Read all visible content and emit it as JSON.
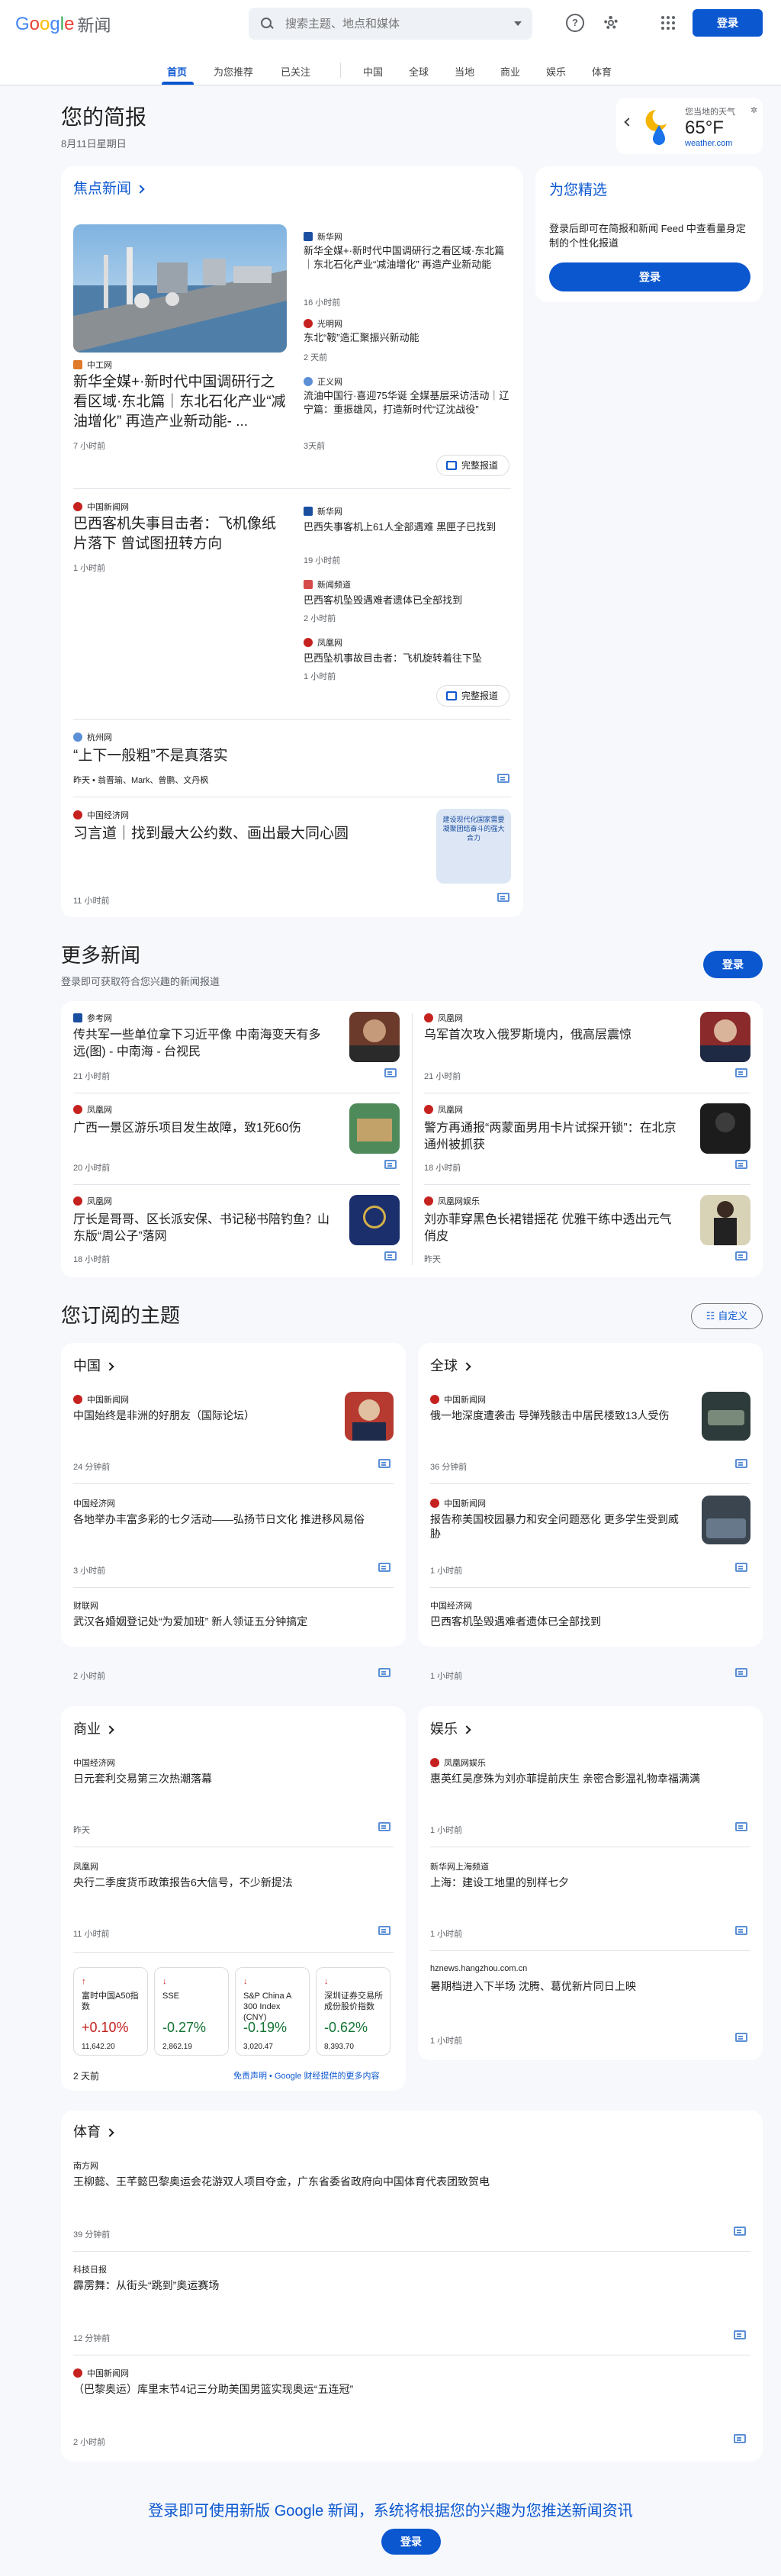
{
  "header": {
    "logo_g": [
      "G",
      "o",
      "o",
      "g",
      "l",
      "e"
    ],
    "logo_news": "新闻",
    "search_placeholder": "搜索主题、地点和媒体",
    "login": "登录",
    "help": "?"
  },
  "nav": {
    "items": [
      "首页",
      "为您推荐",
      "已关注",
      "中国",
      "全球",
      "当地",
      "商业",
      "娱乐",
      "体育"
    ]
  },
  "briefing": {
    "title": "您的简报",
    "date": "8月11日星期日"
  },
  "weather": {
    "location": "您当地的天气",
    "temp": "65°F",
    "source": "weather.com"
  },
  "headlines": {
    "title": "焦点新闻",
    "full_coverage": "完整报道",
    "s1": {
      "main_source": "中工网",
      "main_title": "新华全媒+·新时代中国调研行之看区域·东北篇｜东北石化产业“减油增化” 再造产业新动能- ...",
      "main_time": "7 小时前",
      "side": [
        {
          "source": "新华网",
          "title": "新华全媒+·新时代中国调研行之看区域·东北篇｜东北石化产业“减油增化” 再造产业新动能",
          "time": "16 小时前"
        },
        {
          "source": "光明网",
          "title": "东北“鞍”造汇聚振兴新动能",
          "time": "2 天前"
        },
        {
          "source": "正义网",
          "title": "流油中国行·喜迎75华诞 全媒基层采访活动｜辽宁篇：重振雄风，打造新时代“辽沈战役”",
          "time": "3天前"
        }
      ]
    },
    "s2": {
      "main_source": "中国新闻网",
      "main_title": "巴西客机失事目击者：飞机像纸片落下 曾试图扭转方向",
      "main_time": "1 小时前",
      "side": [
        {
          "source": "新华网",
          "title": "巴西失事客机上61人全部遇难 黑匣子已找到",
          "time": "19 小时前"
        },
        {
          "source": "新闻频道",
          "title": "巴西客机坠毁遇难者遗体已全部找到",
          "time": "2 小时前"
        },
        {
          "source": "凤凰网",
          "title": "巴西坠机事故目击者：飞机旋转着往下坠",
          "time": "1 小时前"
        }
      ]
    },
    "s3": {
      "source": "杭州网",
      "title": "“上下一般粗”不是真落实",
      "meta": "昨天 • 翁晋瑜、Mark、曾鹏、文丹枫"
    },
    "s4": {
      "source": "中国经济网",
      "title": "习言道｜找到最大公约数、画出最大同心圆",
      "time": "11 小时前",
      "img_text": "建设现代化国家需要凝聚团结奋斗的强大合力"
    }
  },
  "picks": {
    "title": "为您精选",
    "desc": "登录后即可在简报和新闻 Feed 中查看量身定制的个性化报道",
    "login": "登录"
  },
  "more": {
    "title": "更多新闻",
    "subtitle": "登录即可获取符合您兴趣的新闻报道",
    "login": "登录",
    "items": [
      {
        "source": "参考网",
        "title": "传共军一些单位拿下习近平像 中南海变天有多远(图) - 中南海 - 台视民",
        "time": "21 小时前"
      },
      {
        "source": "凤凰网",
        "title": "乌军首次攻入俄罗斯境内，俄高层震惊",
        "time": "21 小时前"
      },
      {
        "source": "凤凰网",
        "title": "广西一景区游乐项目发生故障，致1死60伤",
        "time": "20 小时前"
      },
      {
        "source": "凤凰网",
        "title": "警方再通报“两蒙面男用卡片试探开锁”：在北京通州被抓获",
        "time": "18 小时前"
      },
      {
        "source": "凤凰网",
        "title": "厅长是哥哥、区长派安保、书记秘书陪钓鱼？山东版“周公子”落网",
        "time": "18 小时前"
      },
      {
        "source": "凤凰网娱乐",
        "title": "刘亦菲穿黑色长裙错摇花 优雅干练中透出元气俏皮",
        "time": "昨天"
      }
    ]
  },
  "topics": {
    "title": "您订阅的主题",
    "customize": "自定义",
    "china": {
      "title": "中国",
      "items": [
        {
          "source": "中国新闻网",
          "title": "中国始终是非洲的好朋友（国际论坛）",
          "time": "24 分钟前"
        },
        {
          "source": "中国经济网",
          "title": "各地举办丰富多彩的七夕活动——弘扬节日文化 推进移风易俗",
          "time": "3 小时前"
        },
        {
          "source": "财联网",
          "title": "武汉各婚姻登记处“为爱加班” 新人领证五分钟搞定",
          "time": "2 小时前"
        }
      ]
    },
    "world": {
      "title": "全球",
      "items": [
        {
          "source": "中国新闻网",
          "title": "俄一地深度遭袭击 导弹残骸击中居民楼致13人受伤",
          "time": "36 分钟前"
        },
        {
          "source": "中国新闻网",
          "title": "报告称美国校园暴力和安全问题恶化 更多学生受到威胁",
          "time": "1 小时前"
        },
        {
          "source": "中国经济网",
          "title": "巴西客机坠毁遇难者遗体已全部找到",
          "time": "1 小时前"
        }
      ]
    },
    "business": {
      "title": "商业",
      "items": [
        {
          "source": "中国经济网",
          "title": "日元套利交易第三次热潮落幕",
          "time": "昨天"
        },
        {
          "source": "凤凰网",
          "title": "央行二季度货币政策报告6大信号，不少新提法",
          "time": "11 小时前"
        }
      ],
      "stocks": [
        {
          "arrow": "↑",
          "name": "富时中国A50指数",
          "pct": "+0.10%",
          "price": "11,642.20",
          "dir": "up"
        },
        {
          "arrow": "↓",
          "name": "SSE",
          "pct": "-0.27%",
          "price": "2,862.19",
          "dir": "dn"
        },
        {
          "arrow": "↓",
          "name": "S&P China A 300 Index (CNY)",
          "pct": "-0.19%",
          "price": "3,020.47",
          "dir": "dn"
        },
        {
          "arrow": "↓",
          "name": "深圳证券交易所成份股价指数",
          "pct": "-0.62%",
          "price": "8,393.70",
          "dir": "dn"
        }
      ],
      "stock_time": "2 天前",
      "disclaimer": "免责声明 • Google 财经提供的更多内容"
    },
    "ent": {
      "title": "娱乐",
      "items": [
        {
          "source": "凤凰网娱乐",
          "title": "惠英红吴彦殊为刘亦菲提前庆生 亲密合影温礼物幸福满满",
          "time": "1 小时前"
        },
        {
          "source": "新华网上海频道",
          "title": "上海：建设工地里的别样七夕",
          "time": "1 小时前"
        },
        {
          "source": "hznews.hangzhou.com.cn",
          "title": "暑期档进入下半场 沈腾、葛优新片同日上映",
          "time": "1 小时前"
        }
      ]
    },
    "sports": {
      "title": "体育",
      "items": [
        {
          "source": "南方网",
          "title": "王柳懿、王芊懿巴黎奥运会花游双人项目夺金，广东省委省政府向中国体育代表团致贺电",
          "time": "39 分钟前"
        },
        {
          "source": "科技日报",
          "title": "霹雳舞：从街头“跳到”奥运赛场",
          "time": "12 分钟前"
        },
        {
          "source": "中国新闻网",
          "title": "（巴黎奥运）库里末节4记三分助美国男篮实现奥运“五连冠”",
          "time": "2 小时前"
        }
      ]
    }
  },
  "footer": {
    "text": "登录即可使用新版 Google 新闻，系统将根据您的兴趣为您推送新闻资讯",
    "login": "登录"
  },
  "colors": {
    "accent": "#0b57d0",
    "bg": "#f6f8fc",
    "card": "#ffffff",
    "up": "#c5221f",
    "down": "#137333"
  }
}
